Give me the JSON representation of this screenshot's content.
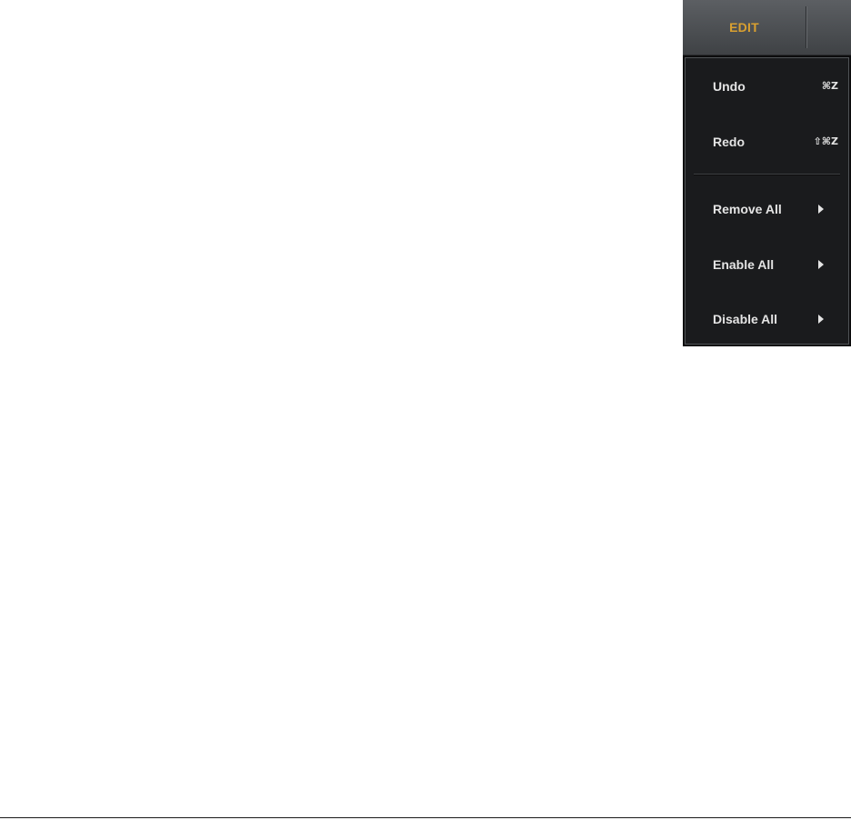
{
  "menu": {
    "title": "EDIT",
    "title_color": "#d9a030",
    "background_color": "#1a1b1d",
    "items": [
      {
        "label": "Undo",
        "shortcut": "⌘Z"
      },
      {
        "label": "Redo",
        "shortcut": "⇧⌘Z"
      },
      {
        "label": "Remove All",
        "submenu_icon": "chevron-right-icon"
      },
      {
        "label": "Enable All",
        "submenu_icon": "chevron-right-icon"
      },
      {
        "label": "Disable All",
        "submenu_icon": "chevron-right-icon"
      }
    ]
  }
}
